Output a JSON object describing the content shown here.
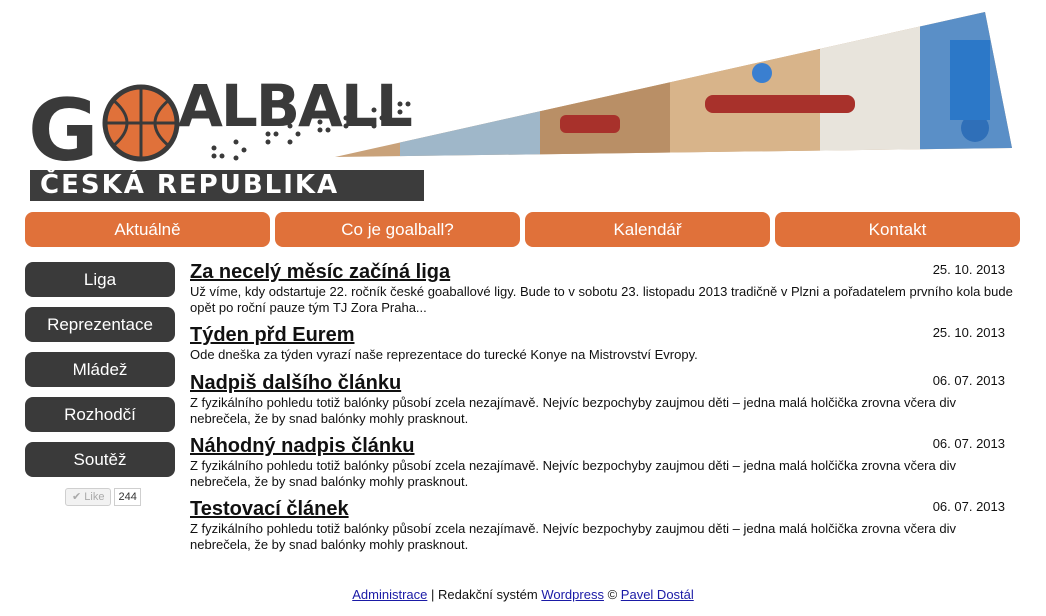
{
  "header": {
    "logo_text": "GOALBALL",
    "country": "ČESKÁ REPUBLIKA",
    "colors": {
      "orange": "#e0713a",
      "dark": "#3a3a3a"
    }
  },
  "topnav": [
    {
      "label": "Aktuálně"
    },
    {
      "label": "Co je goalball?"
    },
    {
      "label": "Kalendář"
    },
    {
      "label": "Kontakt"
    }
  ],
  "sidenav": [
    {
      "label": "Liga"
    },
    {
      "label": "Reprezentace"
    },
    {
      "label": "Mládež"
    },
    {
      "label": "Rozhodčí"
    },
    {
      "label": "Soutěž"
    }
  ],
  "like": {
    "label": "Like",
    "count": "244"
  },
  "articles": [
    {
      "title": "Za necelý měsíc začíná liga",
      "date": "25. 10. 2013",
      "lines": [
        "Už víme, kdy odstartuje 22. ročník české goaballové ligy. Bude to v sobotu 23. listopadu 2013 tradičně v Plzni a pořadatelem prvního kola bude",
        "opět po roční pauze tým TJ Zora Praha..."
      ]
    },
    {
      "title": "Týden přd Eurem",
      "date": "25. 10. 2013",
      "lines": [
        "Ode dneška za týden vyrazí naše reprezentace do turecké Konye na Mistrovství Evropy."
      ]
    },
    {
      "title": "Nadpiš dalšího článku",
      "date": "06. 07. 2013",
      "lines": [
        "Z fyzikálního pohledu totiž balónky působí zcela nezajímavě. Nejvíc bezpochyby zaujmou děti – jedna malá holčička zrovna včera div",
        "nebrečela, že by snad balónky mohly prasknout."
      ]
    },
    {
      "title": "Náhodný nadpis článku",
      "date": "06. 07. 2013",
      "lines": [
        "Z fyzikálního pohledu totiž balónky působí zcela nezajímavě. Nejvíc bezpochyby zaujmou děti – jedna malá holčička zrovna včera div",
        "nebrečela, že by snad balónky mohly prasknout."
      ]
    },
    {
      "title": "Testovací článek",
      "date": "06. 07. 2013",
      "lines": [
        "Z fyzikálního pohledu totiž balónky působí zcela nezajímavě. Nejvíc bezpochyby zaujmou děti – jedna malá holčička zrovna včera div",
        "nebrečela, že by snad balónky mohly prasknout."
      ]
    }
  ],
  "footer": {
    "admin": "Administrace",
    "sep": "|",
    "system_text": "Redakční systém",
    "wordpress": "Wordpress",
    "copyright": "©",
    "author": "Pavel Dostál"
  }
}
